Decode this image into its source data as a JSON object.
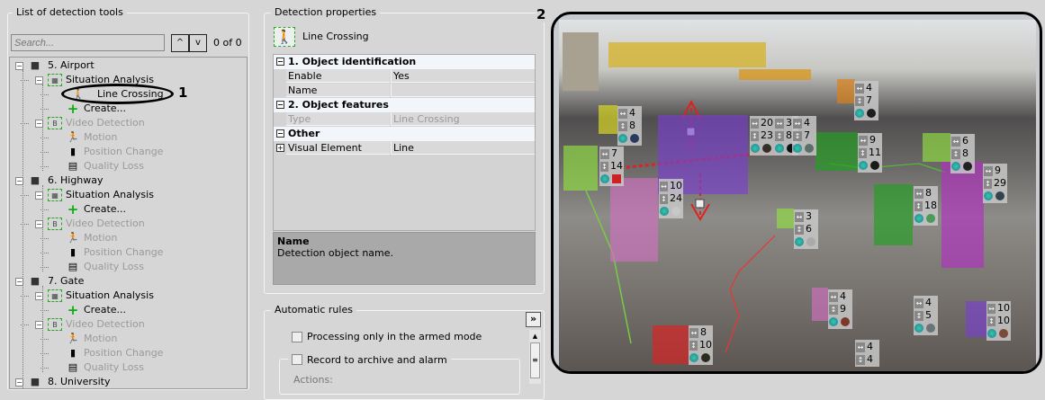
{
  "left_panel": {
    "title": "List of detection tools",
    "search_placeholder": "Search...",
    "prev_label": "^",
    "next_label": "v",
    "counter": "0 of 0",
    "callout": "1",
    "tree": [
      {
        "label": "5. Airport",
        "level": 0,
        "icon": "camera-icon",
        "expander": "−",
        "disabled": false
      },
      {
        "label": "Situation Analysis",
        "level": 1,
        "icon": "situation-analysis-icon",
        "expander": "−",
        "disabled": false
      },
      {
        "label": "Line Crossing",
        "level": 2,
        "icon": "line-crossing-icon",
        "disabled": false,
        "selected": true
      },
      {
        "label": "Create...",
        "level": 2,
        "icon": "create-icon",
        "disabled": false
      },
      {
        "label": "Video Detection",
        "level": 1,
        "icon": "video-detection-icon",
        "expander": "−",
        "disabled": true
      },
      {
        "label": "Motion",
        "level": 2,
        "icon": "motion-icon",
        "disabled": true
      },
      {
        "label": "Position Change",
        "level": 2,
        "icon": "position-change-icon",
        "disabled": true
      },
      {
        "label": "Quality Loss",
        "level": 2,
        "icon": "quality-loss-icon",
        "disabled": true
      },
      {
        "label": "6. Highway",
        "level": 0,
        "icon": "camera-icon",
        "expander": "−",
        "disabled": false
      },
      {
        "label": "Situation Analysis",
        "level": 1,
        "icon": "situation-analysis-icon",
        "expander": "−",
        "disabled": false
      },
      {
        "label": "Create...",
        "level": 2,
        "icon": "create-icon",
        "disabled": false
      },
      {
        "label": "Video Detection",
        "level": 1,
        "icon": "video-detection-icon",
        "expander": "−",
        "disabled": true
      },
      {
        "label": "Motion",
        "level": 2,
        "icon": "motion-icon",
        "disabled": true
      },
      {
        "label": "Position Change",
        "level": 2,
        "icon": "position-change-icon",
        "disabled": true
      },
      {
        "label": "Quality Loss",
        "level": 2,
        "icon": "quality-loss-icon",
        "disabled": true
      },
      {
        "label": "7. Gate",
        "level": 0,
        "icon": "camera-icon",
        "expander": "−",
        "disabled": false
      },
      {
        "label": "Situation Analysis",
        "level": 1,
        "icon": "situation-analysis-icon",
        "expander": "−",
        "disabled": false
      },
      {
        "label": "Create...",
        "level": 2,
        "icon": "create-icon",
        "disabled": false
      },
      {
        "label": "Video Detection",
        "level": 1,
        "icon": "video-detection-icon",
        "expander": "−",
        "disabled": true
      },
      {
        "label": "Motion",
        "level": 2,
        "icon": "motion-icon",
        "disabled": true
      },
      {
        "label": "Position Change",
        "level": 2,
        "icon": "position-change-icon",
        "disabled": true
      },
      {
        "label": "Quality Loss",
        "level": 2,
        "icon": "quality-loss-icon",
        "disabled": true
      },
      {
        "label": "8. University",
        "level": 0,
        "icon": "camera-icon",
        "expander": "−",
        "disabled": false
      }
    ]
  },
  "properties": {
    "title": "Detection properties",
    "callout": "2",
    "object_label": "Line Crossing",
    "grid": [
      {
        "type": "section",
        "label": "1. Object identification",
        "expander": "−"
      },
      {
        "type": "row",
        "name": "Enable",
        "value": "Yes"
      },
      {
        "type": "row",
        "name": "Name",
        "value": ""
      },
      {
        "type": "section",
        "label": "2. Object features",
        "expander": "−"
      },
      {
        "type": "row",
        "name": "Type",
        "value": "Line Crossing",
        "disabled": true
      },
      {
        "type": "section",
        "label": "Other",
        "expander": "−"
      },
      {
        "type": "row",
        "name": "Visual Element",
        "value": "Line",
        "expander": "+"
      }
    ],
    "description_title": "Name",
    "description_text": "Detection object name."
  },
  "rules": {
    "title": "Automatic rules",
    "expand_label": "»",
    "armed_only_label": "Processing only in the armed mode",
    "armed_only_checked": false,
    "record_label": "Record to archive and alarm",
    "record_checked": false,
    "actions_label": "Actions:"
  },
  "video": {
    "tags": [
      {
        "w": "4",
        "h": "8",
        "color": "#2a3a5e"
      },
      {
        "w": "7",
        "h": "14",
        "color": "#cc2222",
        "alarm": true
      },
      {
        "w": "10",
        "h": "24",
        "color": "#c8c8c8"
      },
      {
        "w": "20",
        "h": "23",
        "color": "#333028"
      },
      {
        "w": "3",
        "h": "8",
        "color": "#111111"
      },
      {
        "w": "4",
        "h": "7",
        "color": "#5e6e6a"
      },
      {
        "w": "4",
        "h": "7",
        "color": "#1e1e1e"
      },
      {
        "w": "9",
        "h": "11",
        "color": "#1a1a1a"
      },
      {
        "w": "6",
        "h": "8",
        "color": "#222222"
      },
      {
        "w": "9",
        "h": "29",
        "color": "#34444e"
      },
      {
        "w": "8",
        "h": "18",
        "color": "#4a9a5a"
      },
      {
        "w": "3",
        "h": "6",
        "color": "#aaaaaa"
      },
      {
        "w": "4",
        "h": "9",
        "color": "#7a3a2a"
      },
      {
        "w": "4",
        "h": "5",
        "color": "#6a7478"
      },
      {
        "w": "10",
        "h": "10",
        "color": "#7a4a3a"
      },
      {
        "w": "8",
        "h": "10",
        "color": "#2e2a22"
      },
      {
        "w": "4",
        "h": "4",
        "color": ""
      }
    ],
    "zone_colors": {
      "purple": "#7a3fd0",
      "magenta": "#b030c0",
      "green": "#20a020",
      "lime": "#90e040",
      "pink": "#d070c0",
      "orange": "#e08010",
      "red": "#e02020",
      "yellow": "#e0e020"
    },
    "line_color": "#dd2222"
  }
}
